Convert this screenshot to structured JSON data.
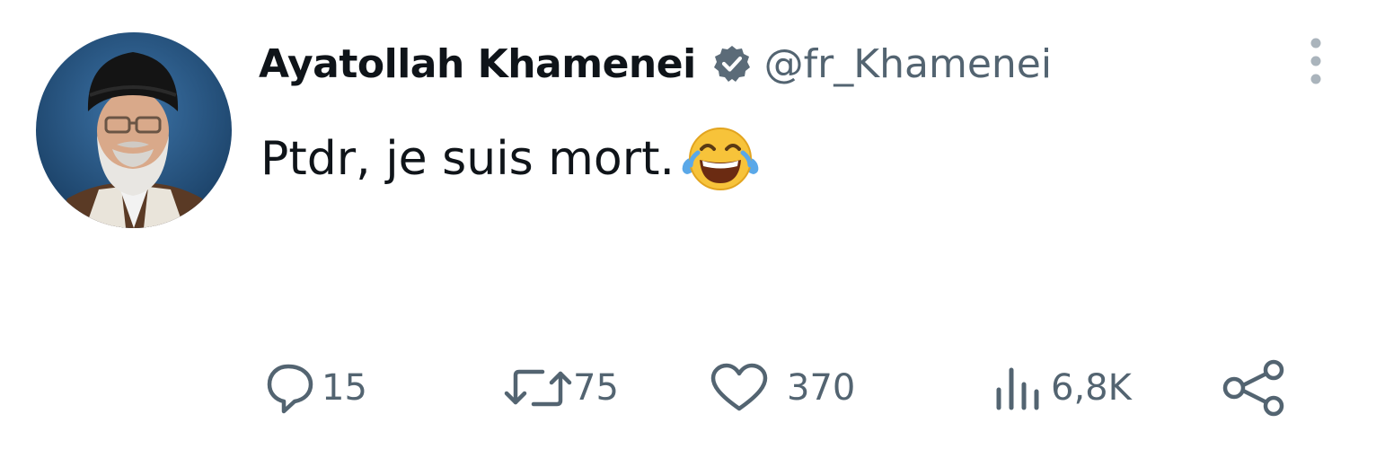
{
  "tweet": {
    "display_name": "Ayatollah Khamenei",
    "verified_icon": "verified-badge-icon",
    "handle": "@fr_Khamenei",
    "text": "Ptdr, je suis mort.",
    "emoji": "face-with-tears-of-joy-emoji",
    "more_icon": "vertical-dots-icon"
  },
  "actions": {
    "reply": {
      "icon": "comment-bubble-icon",
      "count": "15"
    },
    "repost": {
      "icon": "repost-arrows-icon",
      "count": "75"
    },
    "like": {
      "icon": "heart-icon",
      "count": "370"
    },
    "views": {
      "icon": "bar-chart-icon",
      "count": "6,8K"
    },
    "share": {
      "icon": "share-nodes-icon"
    }
  },
  "colors": {
    "text_primary": "#0f1419",
    "text_secondary": "#536471",
    "verified_badge": "#5b6b78",
    "more_dots": "#aab4bc",
    "avatar_background": "#1f4e7a"
  }
}
